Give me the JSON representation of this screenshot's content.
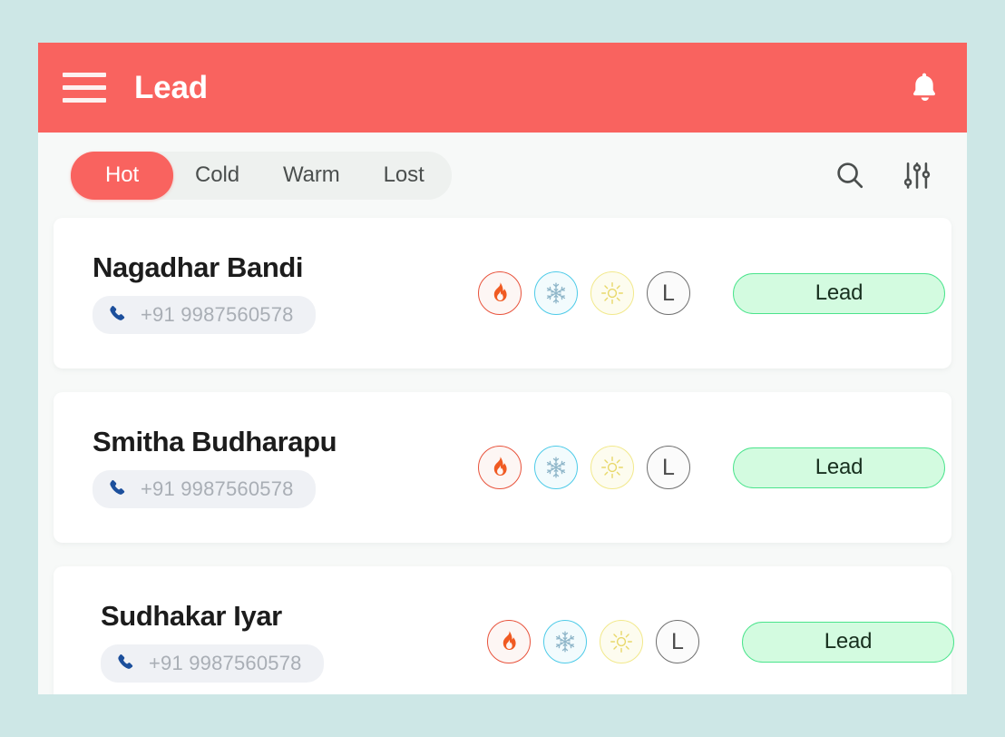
{
  "theme": {
    "page_background": "#cde7e6",
    "app_background": "#f7f9f8",
    "accent": "#f9635f",
    "card_background": "#ffffff",
    "status_pill_background": "#d3fbe0",
    "status_pill_border": "#4ae48c",
    "hot_color": "#e8533c",
    "cold_color": "#4ecbe8",
    "warm_color": "#f2e98c",
    "lost_color": "#6f6f6f",
    "phone_icon_color": "#1c4f9c",
    "phone_text_color": "#a9aeb5"
  },
  "app_bar": {
    "title": "Lead",
    "menu_icon": "hamburger-menu-icon",
    "notification_icon": "bell-icon"
  },
  "tab_bar": {
    "tabs": [
      {
        "label": "Hot",
        "active": true
      },
      {
        "label": "Cold",
        "active": false
      },
      {
        "label": "Warm",
        "active": false
      },
      {
        "label": "Lost",
        "active": false
      }
    ],
    "actions": [
      {
        "icon": "search-icon"
      },
      {
        "icon": "filter-sliders-icon"
      }
    ]
  },
  "leads": [
    {
      "name": "Nagadhar Bandi",
      "phone": "+91 9987560578",
      "phone_icon": "phone-icon",
      "status_icons": [
        {
          "name": "flame-icon",
          "label": "Hot"
        },
        {
          "name": "snowflake-icon",
          "label": "Cold"
        },
        {
          "name": "sun-icon",
          "label": "Warm"
        },
        {
          "name": "letter-l-icon",
          "label": "L"
        }
      ],
      "status_label": "Lead"
    },
    {
      "name": "Smitha Budharapu",
      "phone": "+91 9987560578",
      "phone_icon": "phone-icon",
      "status_icons": [
        {
          "name": "flame-icon",
          "label": "Hot"
        },
        {
          "name": "snowflake-icon",
          "label": "Cold"
        },
        {
          "name": "sun-icon",
          "label": "Warm"
        },
        {
          "name": "letter-l-icon",
          "label": "L"
        }
      ],
      "status_label": "Lead"
    },
    {
      "name": "Sudhakar Iyar",
      "phone": "+91 9987560578",
      "phone_icon": "phone-icon",
      "status_icons": [
        {
          "name": "flame-icon",
          "label": "Hot"
        },
        {
          "name": "snowflake-icon",
          "label": "Cold"
        },
        {
          "name": "sun-icon",
          "label": "Warm"
        },
        {
          "name": "letter-l-icon",
          "label": "L"
        }
      ],
      "status_label": "Lead"
    }
  ]
}
